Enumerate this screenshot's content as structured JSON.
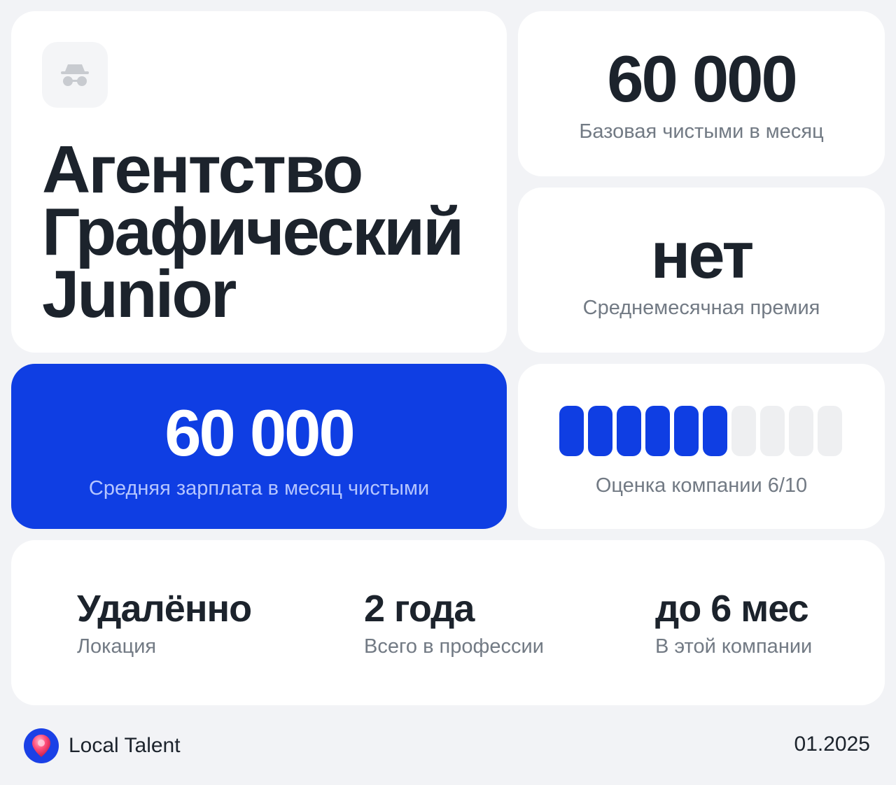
{
  "title": {
    "lines": [
      "Агентство",
      "Графический",
      "Junior"
    ],
    "icon": "incognito-icon"
  },
  "base_salary": {
    "value": "60 000",
    "label": "Базовая чистыми в месяц"
  },
  "bonus": {
    "value": "нет",
    "label": "Среднемесячная премия"
  },
  "average_salary": {
    "value": "60 000",
    "label": "Средняя зарплата в месяц чистыми"
  },
  "rating": {
    "score": 6,
    "max": 10,
    "label": "Оценка компании 6/10"
  },
  "info": [
    {
      "value": "Удалённо",
      "label": "Локация"
    },
    {
      "value": "2 года",
      "label": "Всего в профессии"
    },
    {
      "value": "до 6 мес",
      "label": "В этой компании"
    }
  ],
  "footer": {
    "brand": "Local Talent",
    "date": "01.2025",
    "logo_icon": "location-pin-icon"
  },
  "colors": {
    "accent": "#0f3ee3",
    "text": "#1c232c",
    "muted": "#727a84",
    "background": "#f2f3f6"
  }
}
